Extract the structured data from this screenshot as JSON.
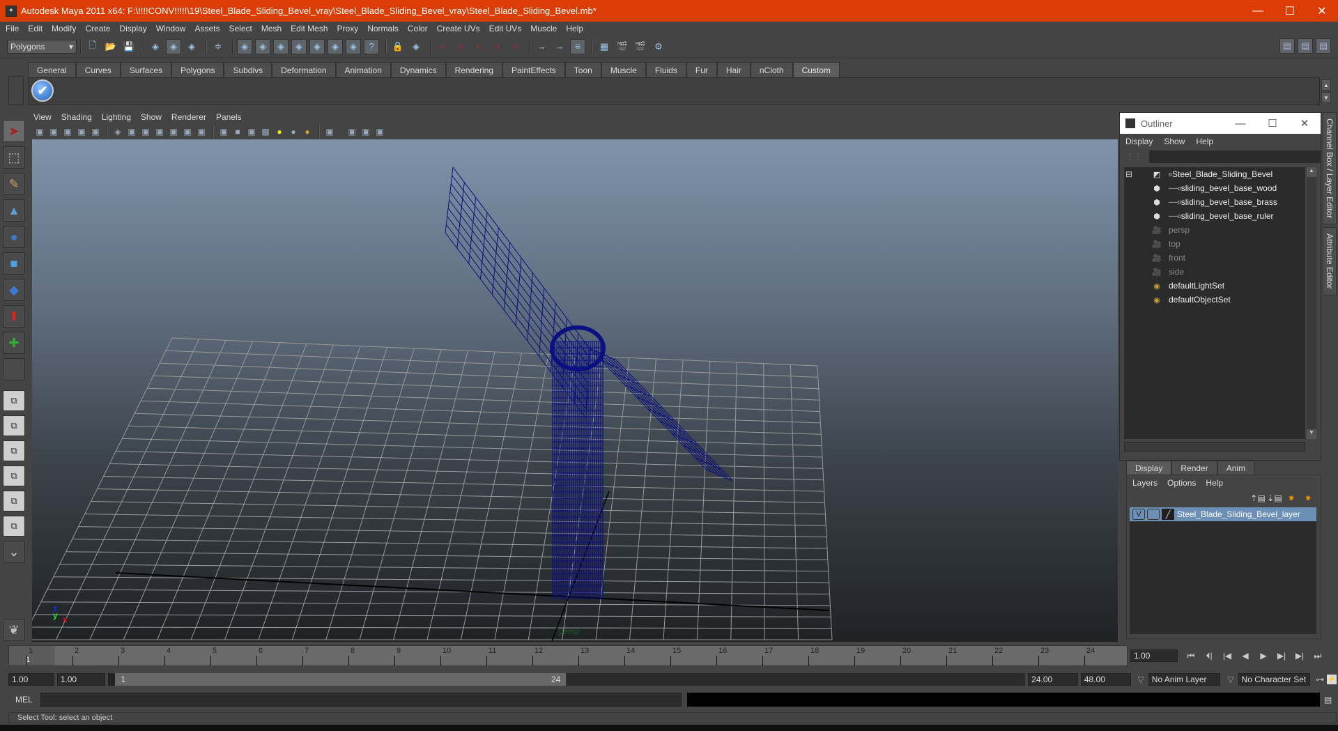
{
  "window": {
    "title": "Autodesk Maya 2011 x64: F:\\!!!!CONV!!!!!\\19\\Steel_Blade_Sliding_Bevel_vray\\Steel_Blade_Sliding_Bevel_vray\\Steel_Blade_Sliding_Bevel.mb*",
    "app_icon": "maya-icon",
    "controls": {
      "minimize": "—",
      "maximize": "☐",
      "close": "✕"
    }
  },
  "menubar": [
    "File",
    "Edit",
    "Modify",
    "Create",
    "Display",
    "Window",
    "Assets",
    "Select",
    "Mesh",
    "Edit Mesh",
    "Proxy",
    "Normals",
    "Color",
    "Create UVs",
    "Edit UVs",
    "Muscle",
    "Help"
  ],
  "statusline": {
    "menu_set": "Polygons",
    "icons": [
      "new-scene-icon",
      "open-scene-icon",
      "save-scene-icon",
      "select-hierarchy-icon",
      "select-object-icon",
      "select-component-icon",
      "mask-icon",
      "select-handle-icon",
      "select-joint-icon",
      "select-curve-icon",
      "select-surface-icon",
      "select-deformer-icon",
      "select-dynamic-icon",
      "select-render-icon",
      "select-misc-icon",
      "lock-selection-icon",
      "highlight-selection-icon",
      "snap-grid-icon",
      "snap-curve-icon",
      "snap-point-icon",
      "snap-view-plane-icon",
      "snap-live-icon",
      "input-ops-icon",
      "output-ops-icon",
      "construction-history-icon",
      "render-view-icon",
      "render-current-icon",
      "ipr-render-icon",
      "render-settings-icon"
    ],
    "right_icons": [
      "channel-box-icon",
      "tool-settings-icon",
      "layer-editor-icon"
    ]
  },
  "shelf": {
    "tabs": [
      "General",
      "Curves",
      "Surfaces",
      "Polygons",
      "Subdivs",
      "Deformation",
      "Animation",
      "Dynamics",
      "Rendering",
      "PaintEffects",
      "Toon",
      "Muscle",
      "Fluids",
      "Fur",
      "Hair",
      "nCloth",
      "Custom"
    ],
    "active_tab": "Custom",
    "items": [
      {
        "icon": "checkmark-icon",
        "glyph": "✔"
      }
    ]
  },
  "toolbox": {
    "tools": [
      {
        "name": "select-tool",
        "glyph": "➤",
        "color": "#a52020",
        "active": true
      },
      {
        "name": "lasso-tool",
        "glyph": "⬚",
        "color": "#ccc"
      },
      {
        "name": "paint-select-tool",
        "glyph": "✎",
        "color": "#c8a060"
      },
      {
        "name": "move-tool",
        "glyph": "▲",
        "color": "#5a9ed6"
      },
      {
        "name": "rotate-tool",
        "glyph": "●",
        "color": "#3b7bd1"
      },
      {
        "name": "scale-tool",
        "glyph": "■",
        "color": "#4fa0e0"
      },
      {
        "name": "manipulator-tool",
        "glyph": "◆",
        "color": "#3b7bd1"
      },
      {
        "name": "soft-mod-tool",
        "glyph": "⬆",
        "color": "#d22"
      },
      {
        "name": "last-tool",
        "glyph": "✚",
        "color": "#3a3"
      },
      {
        "name": "empty-tool",
        "glyph": "",
        "color": "#ccc"
      }
    ],
    "layouts": [
      "single-perspective-layout",
      "four-view-layout",
      "persp-outliner-layout",
      "persp-graph-layout",
      "hypershade-persp-layout",
      "persp-graph-hypergraph-layout"
    ],
    "more": "⌄",
    "logo": "maya-logo-icon"
  },
  "viewport": {
    "menu": [
      "View",
      "Shading",
      "Lighting",
      "Show",
      "Renderer",
      "Panels"
    ],
    "toolbar_icons": [
      "camera-select-icon",
      "camera-attributes-icon",
      "bookmark-icon",
      "image-plane-icon",
      "2d-pan-zoom-icon",
      "grid-icon",
      "film-gate-icon",
      "resolution-gate-icon",
      "gate-mask-icon",
      "field-chart-icon",
      "safe-action-icon",
      "safe-title-icon",
      "wireframe-icon",
      "smooth-shade-icon",
      "wireframe-on-shaded-icon",
      "textured-icon",
      "use-all-lights-icon",
      "shadows-icon",
      "hq-rendering-icon",
      "isolate-select-icon",
      "xray-icon",
      "xray-joints-icon",
      "component-display-icon"
    ],
    "camera": "persp",
    "axis": {
      "z": "z",
      "y": "y",
      "x": "x"
    }
  },
  "outliner": {
    "title": "Outliner",
    "controls": {
      "minimize": "—",
      "maximize": "☐",
      "close": "✕"
    },
    "menu": [
      "Display",
      "Show",
      "Help"
    ],
    "filter_value": "",
    "items": [
      {
        "label": "Steel_Blade_Sliding_Bevel",
        "icon": "group-transform-icon",
        "indent": 0,
        "expanded": true,
        "dim": false
      },
      {
        "label": "sliding_bevel_base_wood",
        "icon": "mesh-icon",
        "indent": 1,
        "dim": false
      },
      {
        "label": "sliding_bevel_base_brass",
        "icon": "mesh-icon",
        "indent": 1,
        "dim": false
      },
      {
        "label": "sliding_bevel_base_ruler",
        "icon": "mesh-icon",
        "indent": 1,
        "dim": false
      },
      {
        "label": "persp",
        "icon": "camera-icon",
        "indent": 0,
        "dim": true
      },
      {
        "label": "top",
        "icon": "camera-icon",
        "indent": 0,
        "dim": true
      },
      {
        "label": "front",
        "icon": "camera-icon",
        "indent": 0,
        "dim": true
      },
      {
        "label": "side",
        "icon": "camera-icon",
        "indent": 0,
        "dim": true
      },
      {
        "label": "defaultLightSet",
        "icon": "set-icon",
        "indent": 0,
        "dim": false
      },
      {
        "label": "defaultObjectSet",
        "icon": "set-icon",
        "indent": 0,
        "dim": false
      }
    ]
  },
  "side_tabs": [
    "Channel Box / Layer Editor",
    "Attribute Editor"
  ],
  "layer_editor": {
    "tabs": [
      "Display",
      "Render",
      "Anim"
    ],
    "active_tab": "Display",
    "menu": [
      "Layers",
      "Options",
      "Help"
    ],
    "icons": [
      "move-layer-up-icon",
      "move-layer-down-icon",
      "create-empty-layer-icon",
      "create-layer-from-selected-icon"
    ],
    "layers": [
      {
        "visible": "V",
        "playback": "",
        "name": "Steel_Blade_Sliding_Bevel_layer",
        "selected": true
      }
    ]
  },
  "timeline": {
    "ticks": [
      1,
      2,
      3,
      4,
      5,
      6,
      7,
      8,
      9,
      10,
      11,
      12,
      13,
      14,
      15,
      16,
      17,
      18,
      19,
      20,
      21,
      22,
      23,
      24
    ],
    "current_marker": "1",
    "current_frame": "1.00",
    "playback_buttons": [
      {
        "name": "go-to-start-button",
        "glyph": "⏮"
      },
      {
        "name": "step-back-frame-button",
        "glyph": "⏴|"
      },
      {
        "name": "step-back-key-button",
        "glyph": "|◀"
      },
      {
        "name": "play-backwards-button",
        "glyph": "◀"
      },
      {
        "name": "play-forwards-button",
        "glyph": "▶"
      },
      {
        "name": "step-forward-key-button",
        "glyph": "▶|"
      },
      {
        "name": "step-forward-frame-button",
        "glyph": "▶|"
      },
      {
        "name": "go-to-end-button",
        "glyph": "⏭"
      }
    ]
  },
  "range": {
    "start_time": "1.00",
    "playback_start": "1.00",
    "range_start_label": "1",
    "range_end_label": "24",
    "playback_end": "24.00",
    "end_time": "48.00",
    "anim_layer": "No Anim Layer",
    "character_set": "No Character Set"
  },
  "command_line": {
    "label": "MEL",
    "input": "",
    "output": ""
  },
  "help_line": "Select Tool: select an object"
}
